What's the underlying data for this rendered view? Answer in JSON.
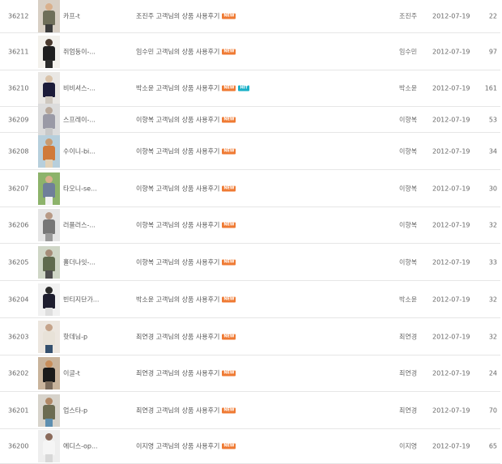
{
  "badges": {
    "new": "NEW",
    "hit": "HIT"
  },
  "rows": [
    {
      "no": "36212",
      "product": "카프-t",
      "subject": "조진주 고객님의 상품 사용후기",
      "hit": false,
      "writer": "조진주",
      "date": "2012-07-19",
      "hits": "22",
      "colors": [
        "#d8cfc4",
        "#d9b08c",
        "#6f6f5a",
        "#3b3b3b"
      ]
    },
    {
      "no": "36211",
      "product": "쥐엄둥이-...",
      "subject": "임수민 고객님의 상품 사용후기",
      "hit": false,
      "writer": "임수민",
      "date": "2012-07-19",
      "hits": "97",
      "colors": [
        "#f3f1ec",
        "#4a3a2e",
        "#1f1f1f",
        "#2b2b2b"
      ]
    },
    {
      "no": "36210",
      "product": "비비셔스-...",
      "subject": "박소윤 고객님의 상품 사용후기",
      "hit": true,
      "writer": "박소윤",
      "date": "2012-07-19",
      "hits": "161",
      "colors": [
        "#e9e7e4",
        "#d9c2a8",
        "#1c1c3a",
        "#cfc8bf"
      ]
    },
    {
      "no": "36209",
      "product": "스프레이-...",
      "subject": "이향복 고객님의 상품 사용후기",
      "hit": false,
      "writer": "이향복",
      "date": "2012-07-19",
      "hits": "53",
      "colors": [
        "#dcdcdc",
        "#b8a89a",
        "#9a9aa6",
        "#c9c9c9"
      ]
    },
    {
      "no": "36208",
      "product": "수이니-bi...",
      "subject": "이향복 고객님의 상품 사용후기",
      "hit": false,
      "writer": "이향복",
      "date": "2012-07-19",
      "hits": "34",
      "colors": [
        "#b7cfdc",
        "#c99a6e",
        "#d07a3a",
        "#e2d2b8"
      ]
    },
    {
      "no": "36207",
      "product": "타오니-se...",
      "subject": "이향복 고객님의 상품 사용후기",
      "hit": false,
      "writer": "이향복",
      "date": "2012-07-19",
      "hits": "30",
      "colors": [
        "#8db36b",
        "#d9b08c",
        "#6f7f9a",
        "#f2f2f2"
      ]
    },
    {
      "no": "36206",
      "product": "러플러스-...",
      "subject": "이향복 고객님의 상품 사용후기",
      "hit": false,
      "writer": "이향복",
      "date": "2012-07-19",
      "hits": "32",
      "colors": [
        "#e5e5e5",
        "#b89a86",
        "#777777",
        "#9a9a9a"
      ]
    },
    {
      "no": "36205",
      "product": "홀더나잇-...",
      "subject": "이향복 고객님의 상품 사용후기",
      "hit": false,
      "writer": "이향복",
      "date": "2012-07-19",
      "hits": "33",
      "colors": [
        "#cfd6c6",
        "#a58c78",
        "#5f6b4e",
        "#4e4e4e"
      ]
    },
    {
      "no": "36204",
      "product": "빈티지단가...",
      "subject": "박소윤 고객님의 상품 사용후기",
      "hit": false,
      "writer": "박소윤",
      "date": "2012-07-19",
      "hits": "32",
      "colors": [
        "#f1f1f1",
        "#2a2a2a",
        "#1d1d2e",
        "#dedede"
      ]
    },
    {
      "no": "36203",
      "product": "핫데님-p",
      "subject": "최연경 고객님의 상품 사용후기",
      "hit": false,
      "writer": "최연경",
      "date": "2012-07-19",
      "hits": "32",
      "colors": [
        "#ece6df",
        "#c5a38a",
        "#e8e2d8",
        "#35506e"
      ]
    },
    {
      "no": "36202",
      "product": "이글-t",
      "subject": "최연경 고객님의 상품 사용후기",
      "hit": false,
      "writer": "최연경",
      "date": "2012-07-19",
      "hits": "24",
      "colors": [
        "#c9b49c",
        "#c78d5a",
        "#1a1a1a",
        "#7a6a5a"
      ]
    },
    {
      "no": "36201",
      "product": "업스타-p",
      "subject": "최연경 고객님의 상품 사용후기",
      "hit": false,
      "writer": "최연경",
      "date": "2012-07-19",
      "hits": "70",
      "colors": [
        "#d7d3cb",
        "#b08866",
        "#6c6c52",
        "#5e8fb0"
      ]
    },
    {
      "no": "36200",
      "product": "에디스-op...",
      "subject": "이지영 고객님의 상품 사용후기",
      "hit": false,
      "writer": "이지영",
      "date": "2012-07-19",
      "hits": "65",
      "colors": [
        "#eeeeee",
        "#8a6a5a",
        "#f5f5f5",
        "#d8d8d8"
      ]
    }
  ]
}
